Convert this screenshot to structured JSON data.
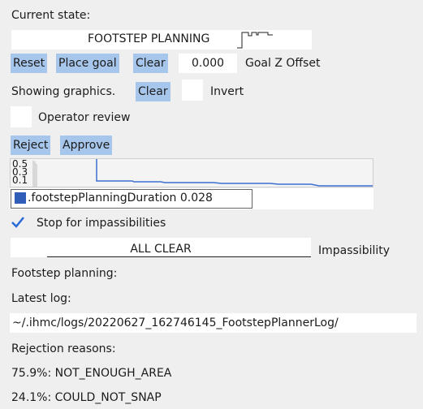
{
  "current_state": {
    "label": "Current state:",
    "value": "FOOTSTEP PLANNING",
    "waveform_icon": "waveform-icon"
  },
  "controls_row": {
    "reset": "Reset",
    "place_goal": "Place goal",
    "clear": "Clear",
    "goal_z_value": "0.000",
    "goal_z_label": "Goal Z Offset"
  },
  "graphics_row": {
    "label": "Showing graphics.",
    "clear": "Clear",
    "invert": "Invert"
  },
  "operator_review": {
    "label": "Operator review",
    "checked": false
  },
  "review_buttons": {
    "reject": "Reject",
    "approve": "Approve"
  },
  "plot": {
    "y_ticks": [
      "0.5",
      "0.3",
      "0.1"
    ],
    "legend_label": ".footstepPlanningDuration 0.028",
    "legend_color": "#2f5db7",
    "line_color": "#3b6fcf"
  },
  "stop_impossibilities": {
    "label": "Stop for impassibilities",
    "checked": true
  },
  "impassibility": {
    "value": "ALL CLEAR",
    "label": "Impassibility"
  },
  "footstep_planning": {
    "label": "Footstep planning:"
  },
  "latest_log": {
    "label": "Latest log:",
    "path": "~/.ihmc/logs/20220627_162746145_FootstepPlannerLog/"
  },
  "rejection": {
    "label": "Rejection reasons:",
    "reasons": [
      "75.9%: NOT_ENOUGH_AREA",
      "24.1%: COULD_NOT_SNAP"
    ]
  }
}
